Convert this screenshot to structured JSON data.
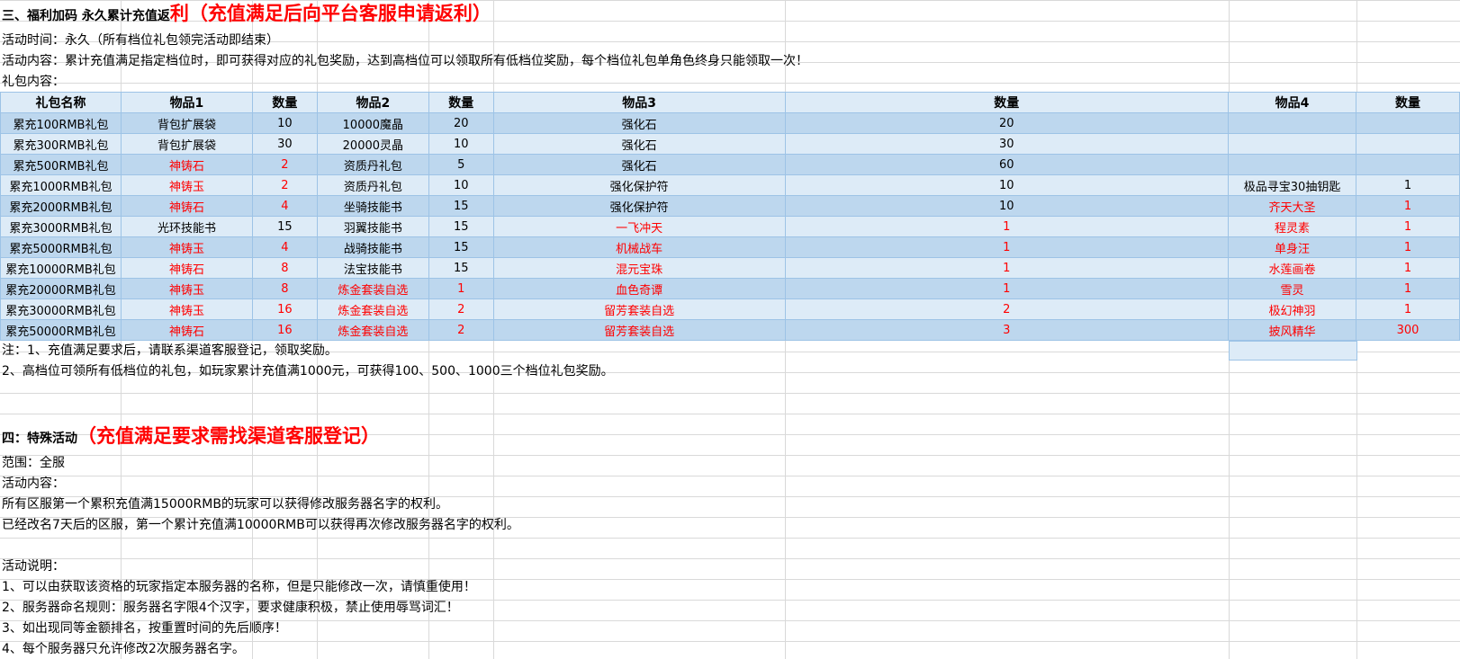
{
  "section3": {
    "title_prefix": "三、福利加码 永久累计充值返",
    "title_red": "利（充值满足后向平台客服申请返利）",
    "time": "活动时间：永久（所有档位礼包领完活动即结束）",
    "content": "活动内容：累计充值满足指定档位时，即可获得对应的礼包奖励，达到高档位可以领取所有低档位奖励，每个档位礼包单角色终身只能领取一次！",
    "gift_label": "礼包内容：",
    "headers": [
      "礼包名称",
      "物品1",
      "数量",
      "物品2",
      "数量",
      "物品3",
      "数量",
      "物品4",
      "数量"
    ],
    "rows": [
      {
        "cells": [
          "累充100RMB礼包",
          "背包扩展袋",
          "10",
          "10000魔晶",
          "20",
          "强化石",
          "20",
          "",
          ""
        ],
        "red": []
      },
      {
        "cells": [
          "累充300RMB礼包",
          "背包扩展袋",
          "30",
          "20000灵晶",
          "10",
          "强化石",
          "30",
          "",
          ""
        ],
        "red": []
      },
      {
        "cells": [
          "累充500RMB礼包",
          "神铸石",
          "2",
          "资质丹礼包",
          "5",
          "强化石",
          "60",
          "",
          ""
        ],
        "red": [
          1,
          2
        ]
      },
      {
        "cells": [
          "累充1000RMB礼包",
          "神铸玉",
          "2",
          "资质丹礼包",
          "10",
          "强化保护符",
          "10",
          "极品寻宝30抽钥匙",
          "1"
        ],
        "red": [
          1,
          2
        ]
      },
      {
        "cells": [
          "累充2000RMB礼包",
          "神铸石",
          "4",
          "坐骑技能书",
          "15",
          "强化保护符",
          "10",
          "齐天大圣",
          "1"
        ],
        "red": [
          1,
          2,
          7,
          8
        ]
      },
      {
        "cells": [
          "累充3000RMB礼包",
          "光环技能书",
          "15",
          "羽翼技能书",
          "15",
          "一飞冲天",
          "1",
          "程灵素",
          "1"
        ],
        "red": [
          5,
          6,
          7,
          8
        ]
      },
      {
        "cells": [
          "累充5000RMB礼包",
          "神铸玉",
          "4",
          "战骑技能书",
          "15",
          "机械战车",
          "1",
          "单身汪",
          "1"
        ],
        "red": [
          1,
          2,
          5,
          6,
          7,
          8
        ]
      },
      {
        "cells": [
          "累充10000RMB礼包",
          "神铸石",
          "8",
          "法宝技能书",
          "15",
          "混元宝珠",
          "1",
          "水莲画卷",
          "1"
        ],
        "red": [
          1,
          2,
          5,
          6,
          7,
          8
        ]
      },
      {
        "cells": [
          "累充20000RMB礼包",
          "神铸玉",
          "8",
          "炼金套装自选",
          "1",
          "血色奇谭",
          "1",
          "雪灵",
          "1"
        ],
        "red": [
          1,
          2,
          3,
          4,
          5,
          6,
          7,
          8
        ]
      },
      {
        "cells": [
          "累充30000RMB礼包",
          "神铸玉",
          "16",
          "炼金套装自选",
          "2",
          "留芳套装自选",
          "2",
          "极幻神羽",
          "1"
        ],
        "red": [
          1,
          2,
          3,
          4,
          5,
          6,
          7,
          8
        ]
      },
      {
        "cells": [
          "累充50000RMB礼包",
          "神铸石",
          "16",
          "炼金套装自选",
          "2",
          "留芳套装自选",
          "3",
          "披风精华",
          "300"
        ],
        "red": [
          1,
          2,
          3,
          4,
          5,
          6,
          7,
          8
        ]
      }
    ],
    "note1": "注：1、充值满足要求后，请联系渠道客服登记，领取奖励。",
    "note2": "2、高档位可领所有低档位的礼包，如玩家累计充值满1000元，可获得100、500、1000三个档位礼包奖励。"
  },
  "section4": {
    "title_prefix": "四：特殊活动",
    "title_red": "（充值满足要求需找渠道客服登记）",
    "scope": "范围：全服",
    "content_label": "活动内容：",
    "line1": "所有区服第一个累积充值满15000RMB的玩家可以获得修改服务器名字的权利。",
    "line2": "已经改名7天后的区服，第一个累计充值满10000RMB可以获得再次修改服务器名字的权利。",
    "desc_label": "活动说明：",
    "rule1": "1、可以由获取该资格的玩家指定本服务器的名称，但是只能修改一次，请慎重使用！",
    "rule2": "2、服务器命名规则：服务器名字限4个汉字，要求健康积极，禁止使用辱骂词汇！",
    "rule3": "3、如出现同等金额排名，按重置时间的先后顺序！",
    "rule4": "4、每个服务器只允许修改2次服务器名字。"
  }
}
